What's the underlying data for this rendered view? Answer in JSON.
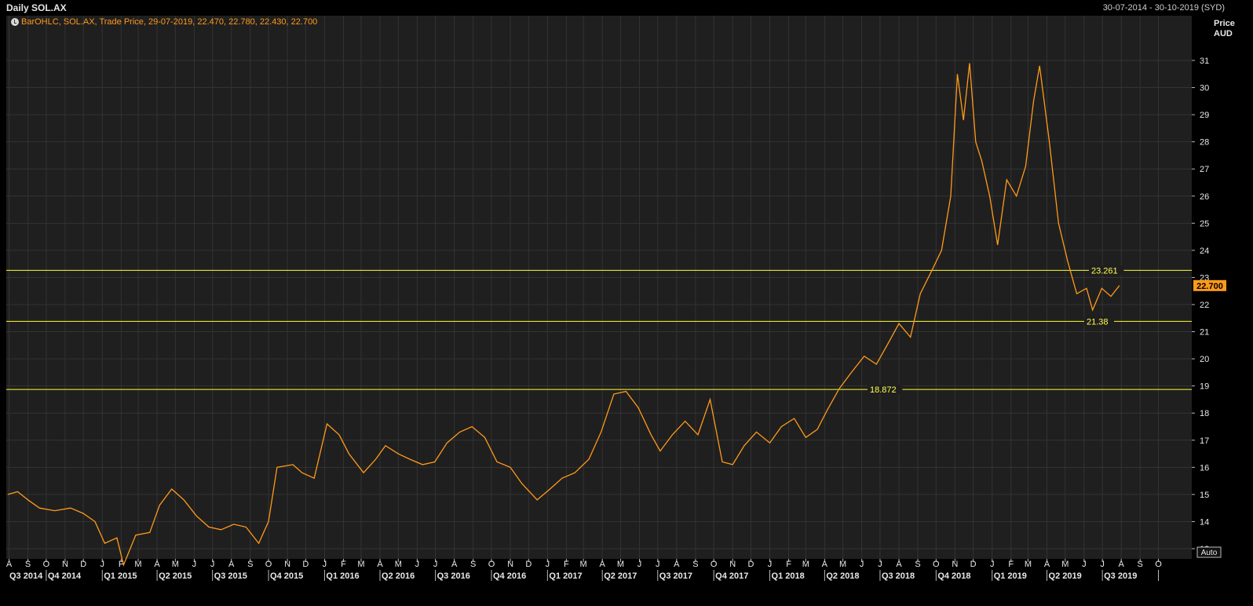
{
  "header": {
    "title": "Daily SOL.AX",
    "date_range": "30-07-2014 - 30-10-2019 (SYD)",
    "legend": "BarOHLC, SOL.AX, Trade Price, 29-07-2019, 22.470, 22.780, 22.430, 22.700"
  },
  "colors": {
    "background": "#1f1f1f",
    "series": "#ff9a1a",
    "horizontal_lines": "#ffff33",
    "grid": "#333333"
  },
  "auto_button": "Auto",
  "chart_data": {
    "type": "line",
    "ylabel": "Price\nAUD",
    "ylabel_lines": [
      "Price",
      "AUD"
    ],
    "ylim": [
      12.5,
      31.8
    ],
    "yticks": [
      13,
      14,
      15,
      16,
      17,
      18,
      19,
      20,
      21,
      22,
      23,
      24,
      25,
      26,
      27,
      28,
      29,
      30,
      31
    ],
    "last_price": "22.700",
    "months": [
      "A",
      "S",
      "O",
      "N",
      "D",
      "J",
      "F",
      "M",
      "A",
      "M",
      "J",
      "J",
      "A",
      "S",
      "O",
      "N",
      "D",
      "J",
      "F",
      "M",
      "A",
      "M",
      "J",
      "J",
      "A",
      "S",
      "O",
      "N",
      "D",
      "J",
      "F",
      "M",
      "A",
      "M",
      "J",
      "J",
      "A",
      "S",
      "O",
      "N",
      "D",
      "J",
      "F",
      "M",
      "A",
      "M",
      "J",
      "J",
      "A",
      "S",
      "O",
      "N",
      "D",
      "J",
      "F",
      "M",
      "A",
      "M",
      "J",
      "J",
      "A",
      "S",
      "O"
    ],
    "quarters": [
      "Q3 2014",
      "Q4 2014",
      "Q1 2015",
      "Q2 2015",
      "Q3 2015",
      "Q4 2015",
      "Q1 2016",
      "Q2 2016",
      "Q3 2016",
      "Q4 2016",
      "Q1 2017",
      "Q2 2017",
      "Q3 2017",
      "Q4 2017",
      "Q1 2018",
      "Q2 2018",
      "Q3 2018",
      "Q4 2018",
      "Q1 2019",
      "Q2 2019",
      "Q3 2019"
    ],
    "horizontal_lines": [
      {
        "value": 23.261,
        "label": "23.261"
      },
      {
        "value": 21.38,
        "label": "21.38"
      },
      {
        "value": 18.872,
        "label": "18.872"
      }
    ],
    "series": [
      {
        "points": [
          [
            "2014-07-30",
            15.0
          ],
          [
            "2014-08-15",
            15.1
          ],
          [
            "2014-09-01",
            14.8
          ],
          [
            "2014-09-20",
            14.5
          ],
          [
            "2014-10-15",
            14.4
          ],
          [
            "2014-11-10",
            14.5
          ],
          [
            "2014-12-01",
            14.3
          ],
          [
            "2014-12-20",
            14.0
          ],
          [
            "2015-01-05",
            13.2
          ],
          [
            "2015-01-25",
            13.4
          ],
          [
            "2015-02-05",
            12.4
          ],
          [
            "2015-02-25",
            13.5
          ],
          [
            "2015-03-20",
            13.6
          ],
          [
            "2015-04-05",
            14.6
          ],
          [
            "2015-04-25",
            15.2
          ],
          [
            "2015-05-15",
            14.8
          ],
          [
            "2015-06-05",
            14.2
          ],
          [
            "2015-06-25",
            13.8
          ],
          [
            "2015-07-15",
            13.7
          ],
          [
            "2015-08-05",
            13.9
          ],
          [
            "2015-08-25",
            13.8
          ],
          [
            "2015-09-15",
            13.2
          ],
          [
            "2015-10-01",
            14.0
          ],
          [
            "2015-10-15",
            16.0
          ],
          [
            "2015-11-10",
            16.1
          ],
          [
            "2015-11-25",
            15.8
          ],
          [
            "2015-12-15",
            15.6
          ],
          [
            "2016-01-05",
            17.6
          ],
          [
            "2016-01-25",
            17.2
          ],
          [
            "2016-02-10",
            16.5
          ],
          [
            "2016-03-05",
            15.8
          ],
          [
            "2016-03-25",
            16.3
          ],
          [
            "2016-04-10",
            16.8
          ],
          [
            "2016-05-01",
            16.5
          ],
          [
            "2016-05-20",
            16.3
          ],
          [
            "2016-06-10",
            16.1
          ],
          [
            "2016-06-30",
            16.2
          ],
          [
            "2016-07-20",
            16.9
          ],
          [
            "2016-08-10",
            17.3
          ],
          [
            "2016-08-30",
            17.5
          ],
          [
            "2016-09-20",
            17.1
          ],
          [
            "2016-10-10",
            16.2
          ],
          [
            "2016-11-01",
            16.0
          ],
          [
            "2016-11-20",
            15.4
          ],
          [
            "2016-12-15",
            14.8
          ],
          [
            "2017-01-05",
            15.2
          ],
          [
            "2017-01-25",
            15.6
          ],
          [
            "2017-02-15",
            15.8
          ],
          [
            "2017-03-10",
            16.3
          ],
          [
            "2017-03-30",
            17.3
          ],
          [
            "2017-04-20",
            18.7
          ],
          [
            "2017-05-10",
            18.8
          ],
          [
            "2017-05-30",
            18.2
          ],
          [
            "2017-06-20",
            17.2
          ],
          [
            "2017-07-05",
            16.6
          ],
          [
            "2017-07-25",
            17.2
          ],
          [
            "2017-08-15",
            17.7
          ],
          [
            "2017-09-05",
            17.2
          ],
          [
            "2017-09-25",
            18.5
          ],
          [
            "2017-10-15",
            16.2
          ],
          [
            "2017-11-01",
            16.1
          ],
          [
            "2017-11-20",
            16.8
          ],
          [
            "2017-12-10",
            17.3
          ],
          [
            "2018-01-01",
            16.9
          ],
          [
            "2018-01-20",
            17.5
          ],
          [
            "2018-02-10",
            17.8
          ],
          [
            "2018-03-01",
            17.1
          ],
          [
            "2018-03-20",
            17.4
          ],
          [
            "2018-04-05",
            18.1
          ],
          [
            "2018-04-25",
            18.9
          ],
          [
            "2018-05-15",
            19.5
          ],
          [
            "2018-06-05",
            20.1
          ],
          [
            "2018-06-25",
            19.8
          ],
          [
            "2018-07-15",
            20.6
          ],
          [
            "2018-08-01",
            21.3
          ],
          [
            "2018-08-20",
            20.8
          ],
          [
            "2018-09-05",
            22.4
          ],
          [
            "2018-09-25",
            23.3
          ],
          [
            "2018-10-10",
            24.0
          ],
          [
            "2018-10-25",
            26.0
          ],
          [
            "2018-11-05",
            30.5
          ],
          [
            "2018-11-15",
            28.8
          ],
          [
            "2018-11-25",
            30.9
          ],
          [
            "2018-12-05",
            28.0
          ],
          [
            "2018-12-15",
            27.3
          ],
          [
            "2018-12-28",
            26.0
          ],
          [
            "2019-01-10",
            24.2
          ],
          [
            "2019-01-25",
            26.6
          ],
          [
            "2019-02-10",
            26.0
          ],
          [
            "2019-02-25",
            27.1
          ],
          [
            "2019-03-10",
            29.5
          ],
          [
            "2019-03-20",
            30.8
          ],
          [
            "2019-04-05",
            28.0
          ],
          [
            "2019-04-20",
            25.0
          ],
          [
            "2019-05-05",
            23.6
          ],
          [
            "2019-05-20",
            22.4
          ],
          [
            "2019-06-05",
            22.6
          ],
          [
            "2019-06-15",
            21.8
          ],
          [
            "2019-06-30",
            22.6
          ],
          [
            "2019-07-15",
            22.3
          ],
          [
            "2019-07-29",
            22.7
          ]
        ]
      }
    ]
  }
}
